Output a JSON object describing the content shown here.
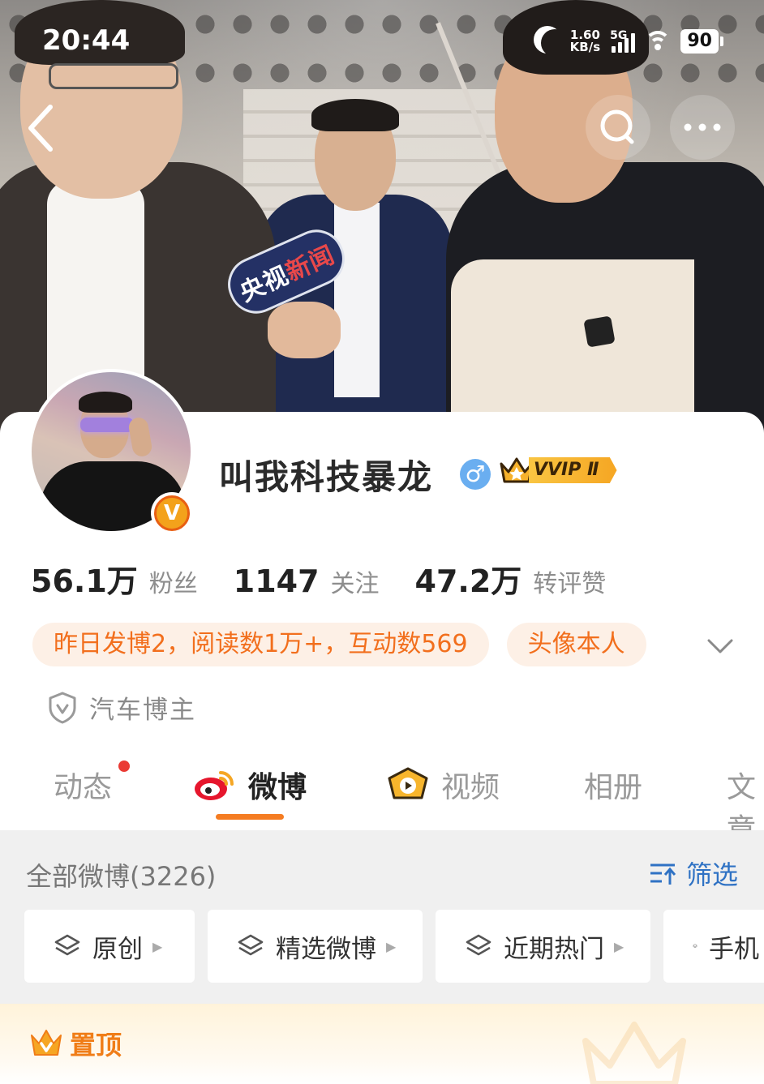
{
  "status_bar": {
    "time": "20:44",
    "net_speed_value": "1.60",
    "net_speed_unit": "KB/s",
    "network": "5G",
    "battery": "90"
  },
  "cover": {
    "mic_brand_part1": "央视",
    "mic_brand_part2": "新闻"
  },
  "nav": {
    "back_icon": "back-arrow-icon",
    "search_icon": "search-icon",
    "more_icon": "more-dots-icon"
  },
  "profile": {
    "name": "叫我科技暴龙",
    "gender_symbol": "♂",
    "vip_label": "VVIP Ⅱ",
    "verified_badge": "V",
    "stats": [
      {
        "value": "56.1万",
        "label": "粉丝"
      },
      {
        "value": "1147",
        "label": "关注"
      },
      {
        "value": "47.2万",
        "label": "转评赞"
      }
    ],
    "chips": [
      "昨日发博2，阅读数1万+，互动数569",
      "头像本人"
    ],
    "verification": "汽车博主"
  },
  "tabs": [
    {
      "label": "动态",
      "has_dot": true
    },
    {
      "label": "微博",
      "active": true
    },
    {
      "label": "视频"
    },
    {
      "label": "相册"
    },
    {
      "label": "文章"
    }
  ],
  "feed": {
    "all_posts_label": "全部微博(3226)",
    "filter_label": "筛选",
    "categories": [
      "原创",
      "精选微博",
      "近期热门",
      "手机"
    ],
    "pinned_label": "置顶"
  },
  "colors": {
    "accent_orange": "#f26f1d",
    "chip_bg": "#fdf0e6",
    "link_blue": "#2f72c4",
    "tab_underline": "#f57c22"
  }
}
